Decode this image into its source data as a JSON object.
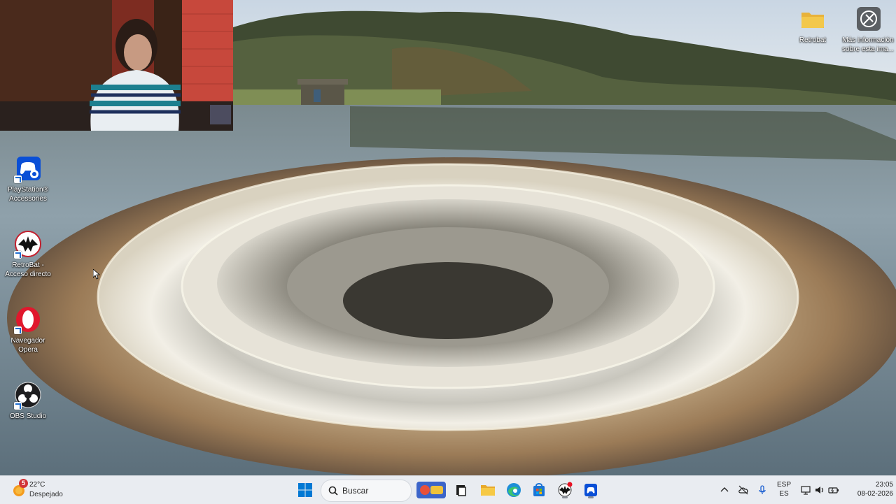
{
  "desktop": {
    "icons": [
      {
        "name": "playstation-accessories",
        "label_line1": "PlayStation®",
        "label_line2": "Accessories",
        "icon": "gamepad-settings-icon"
      },
      {
        "name": "retrobat-shortcut",
        "label_line1": "RetroBat -",
        "label_line2": "Acceso directo",
        "icon": "retrobat-icon"
      },
      {
        "name": "opera-browser",
        "label_line1": "Navegador",
        "label_line2": "Opera",
        "icon": "opera-icon"
      },
      {
        "name": "obs-studio",
        "label_line1": "OBS Studio",
        "label_line2": "",
        "icon": "obs-icon"
      },
      {
        "name": "retrobat-folder",
        "label_line1": "Retrobat",
        "label_line2": "",
        "icon": "folder-icon"
      },
      {
        "name": "wallpaper-info",
        "label_line1": "Más información",
        "label_line2": "sobre esta ima...",
        "icon": "camera-info-icon"
      }
    ]
  },
  "taskbar": {
    "weather": {
      "badge": "5",
      "temperature": "22°C",
      "condition": "Despejado"
    },
    "search_placeholder": "Buscar",
    "pinned": [
      {
        "name": "start-button",
        "icon": "windows-logo-icon"
      },
      {
        "name": "task-view-button",
        "icon": "task-view-icon"
      },
      {
        "name": "file-explorer-button",
        "icon": "folder-icon"
      },
      {
        "name": "edge-button",
        "icon": "edge-icon"
      },
      {
        "name": "store-button",
        "icon": "store-icon"
      },
      {
        "name": "retrobat-app-button",
        "icon": "retrobat-icon"
      },
      {
        "name": "playstation-accessories-app-button",
        "icon": "gamepad-icon"
      }
    ],
    "tray": {
      "language_top": "ESP",
      "language_bottom": "ES",
      "time": "23:05",
      "date": "08-02-2026"
    }
  },
  "colors": {
    "taskbar_bg": "#e9ecf1",
    "windows_blue": "#0078d4",
    "opera_red": "#e0182d",
    "folder_yellow": "#f3c84b"
  }
}
